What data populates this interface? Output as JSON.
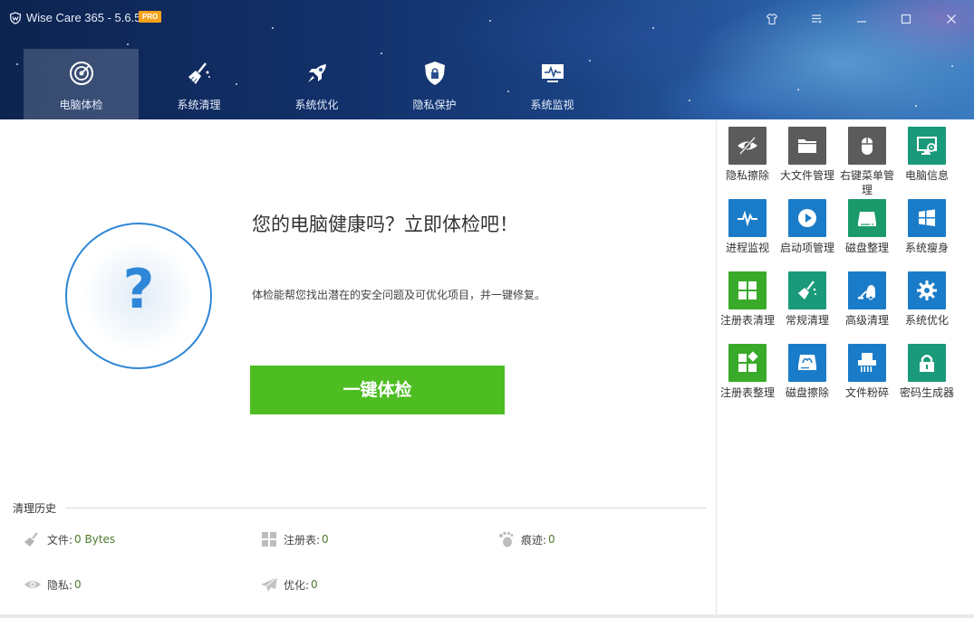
{
  "app": {
    "title": "Wise Care 365 - 5.6.5",
    "badge": "PRO"
  },
  "window_controls": [
    {
      "name": "skin-icon"
    },
    {
      "name": "menu-icon"
    },
    {
      "name": "minimize-icon"
    },
    {
      "name": "maximize-icon"
    },
    {
      "name": "close-icon"
    }
  ],
  "nav": {
    "tabs": [
      {
        "label": "电脑体检",
        "icon": "radar-icon",
        "active": true
      },
      {
        "label": "系统清理",
        "icon": "broom-icon",
        "active": false
      },
      {
        "label": "系统优化",
        "icon": "rocket-icon",
        "active": false
      },
      {
        "label": "隐私保护",
        "icon": "shield-lock-icon",
        "active": false
      },
      {
        "label": "系统监视",
        "icon": "monitor-pulse-icon",
        "active": false
      }
    ]
  },
  "checkup": {
    "headline": "您的电脑健康吗？立即体检吧！",
    "description": "体检能帮您找出潜在的安全问题及可优化项目，并一键修复。",
    "button": "一键体检",
    "status_icon": "?"
  },
  "history": {
    "title": "清理历史",
    "items": [
      {
        "label": "文件:",
        "value": "0 Bytes",
        "icon": "broom-small-icon"
      },
      {
        "label": "注册表:",
        "value": "0",
        "icon": "registry-small-icon"
      },
      {
        "label": "痕迹:",
        "value": "0",
        "icon": "footprint-icon"
      },
      {
        "label": "隐私:",
        "value": "0",
        "icon": "eye-icon"
      },
      {
        "label": "优化:",
        "value": "0",
        "icon": "paper-plane-icon"
      }
    ]
  },
  "tools": [
    {
      "label": "隐私擦除",
      "icon": "eye-slash-icon",
      "color": "#5a5a5a"
    },
    {
      "label": "大文件管理",
      "icon": "folder-icon",
      "color": "#5a5a5a"
    },
    {
      "label": "右键菜单管理",
      "icon": "mouse-icon",
      "color": "#5a5a5a"
    },
    {
      "label": "电脑信息",
      "icon": "computer-info-icon",
      "color": "#1a9a7a"
    },
    {
      "label": "进程监视",
      "icon": "pulse-icon",
      "color": "#1a7cc8"
    },
    {
      "label": "启动项管理",
      "icon": "play-icon",
      "color": "#1a7cc8"
    },
    {
      "label": "磁盘整理",
      "icon": "disk-icon",
      "color": "#1a9a6a"
    },
    {
      "label": "系统瘦身",
      "icon": "windows-icon",
      "color": "#1a7cc8"
    },
    {
      "label": "注册表清理",
      "icon": "grid-icon",
      "color": "#3aaa2a"
    },
    {
      "label": "常规清理",
      "icon": "broom-tool-icon",
      "color": "#1a9a7a"
    },
    {
      "label": "高级清理",
      "icon": "vacuum-icon",
      "color": "#1a7cc8"
    },
    {
      "label": "系统优化",
      "icon": "gear-icon",
      "color": "#1a7cc8"
    },
    {
      "label": "注册表整理",
      "icon": "blocks-icon",
      "color": "#3aaa2a"
    },
    {
      "label": "磁盘擦除",
      "icon": "disk-wipe-icon",
      "color": "#1a7cc8"
    },
    {
      "label": "文件粉碎",
      "icon": "shredder-icon",
      "color": "#1a7cc8"
    },
    {
      "label": "密码生成器",
      "icon": "padlock-icon",
      "color": "#1a9a7a"
    }
  ]
}
